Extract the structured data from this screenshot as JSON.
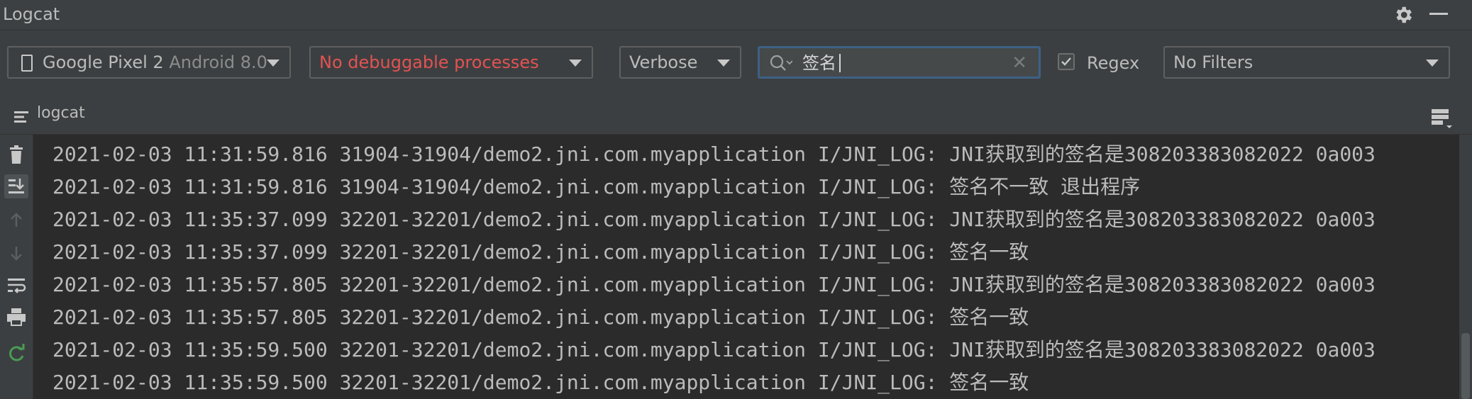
{
  "titlebar": {
    "title": "Logcat",
    "settings_icon": "gear-icon",
    "minimize_icon": "minimize-icon"
  },
  "toolbar": {
    "device": {
      "name": "Google Pixel 2",
      "version": "Android 8.0",
      "icon": "phone-icon"
    },
    "process": {
      "value": "No debuggable processes",
      "color": "#e35252"
    },
    "level": {
      "value": "Verbose"
    },
    "search": {
      "value": "签名",
      "search_icon": "search-icon",
      "clear_glyph": "✕"
    },
    "regex": {
      "checked": true,
      "label": "Regex"
    },
    "filters": {
      "value": "No Filters"
    }
  },
  "tab": {
    "label": "logcat"
  },
  "sidebar": {
    "icons": [
      "trash-icon",
      "scroll-to-end-icon",
      "up-arrow-icon",
      "down-arrow-icon",
      "soft-wrap-icon",
      "print-icon",
      "restart-icon"
    ]
  },
  "log_lines": [
    "2021-02-03 11:31:59.816 31904-31904/demo2.jni.com.myapplication I/JNI_LOG: JNI获取到的签名是308203383082022 0a003",
    "2021-02-03 11:31:59.816 31904-31904/demo2.jni.com.myapplication I/JNI_LOG: 签名不一致 退出程序",
    "2021-02-03 11:35:37.099 32201-32201/demo2.jni.com.myapplication I/JNI_LOG: JNI获取到的签名是308203383082022 0a003",
    "2021-02-03 11:35:37.099 32201-32201/demo2.jni.com.myapplication I/JNI_LOG: 签名一致",
    "2021-02-03 11:35:57.805 32201-32201/demo2.jni.com.myapplication I/JNI_LOG: JNI获取到的签名是308203383082022 0a003",
    "2021-02-03 11:35:57.805 32201-32201/demo2.jni.com.myapplication I/JNI_LOG: 签名一致",
    "2021-02-03 11:35:59.500 32201-32201/demo2.jni.com.myapplication I/JNI_LOG: JNI获取到的签名是308203383082022 0a003",
    "2021-02-03 11:35:59.500 32201-32201/demo2.jni.com.myapplication I/JNI_LOG: 签名一致"
  ]
}
